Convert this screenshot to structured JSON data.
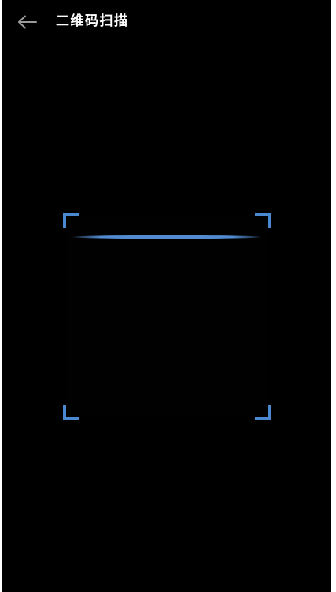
{
  "header": {
    "title": "二维码扫描",
    "back_icon": "arrow-left-icon"
  },
  "scanner": {
    "corner_color": "#4a88d0",
    "line_color": "#5b9ae6",
    "corner_icon": "scan-corner-bracket"
  },
  "colors": {
    "background": "#000000",
    "title_text": "#ffffff",
    "back_arrow": "#9a9a9a"
  }
}
